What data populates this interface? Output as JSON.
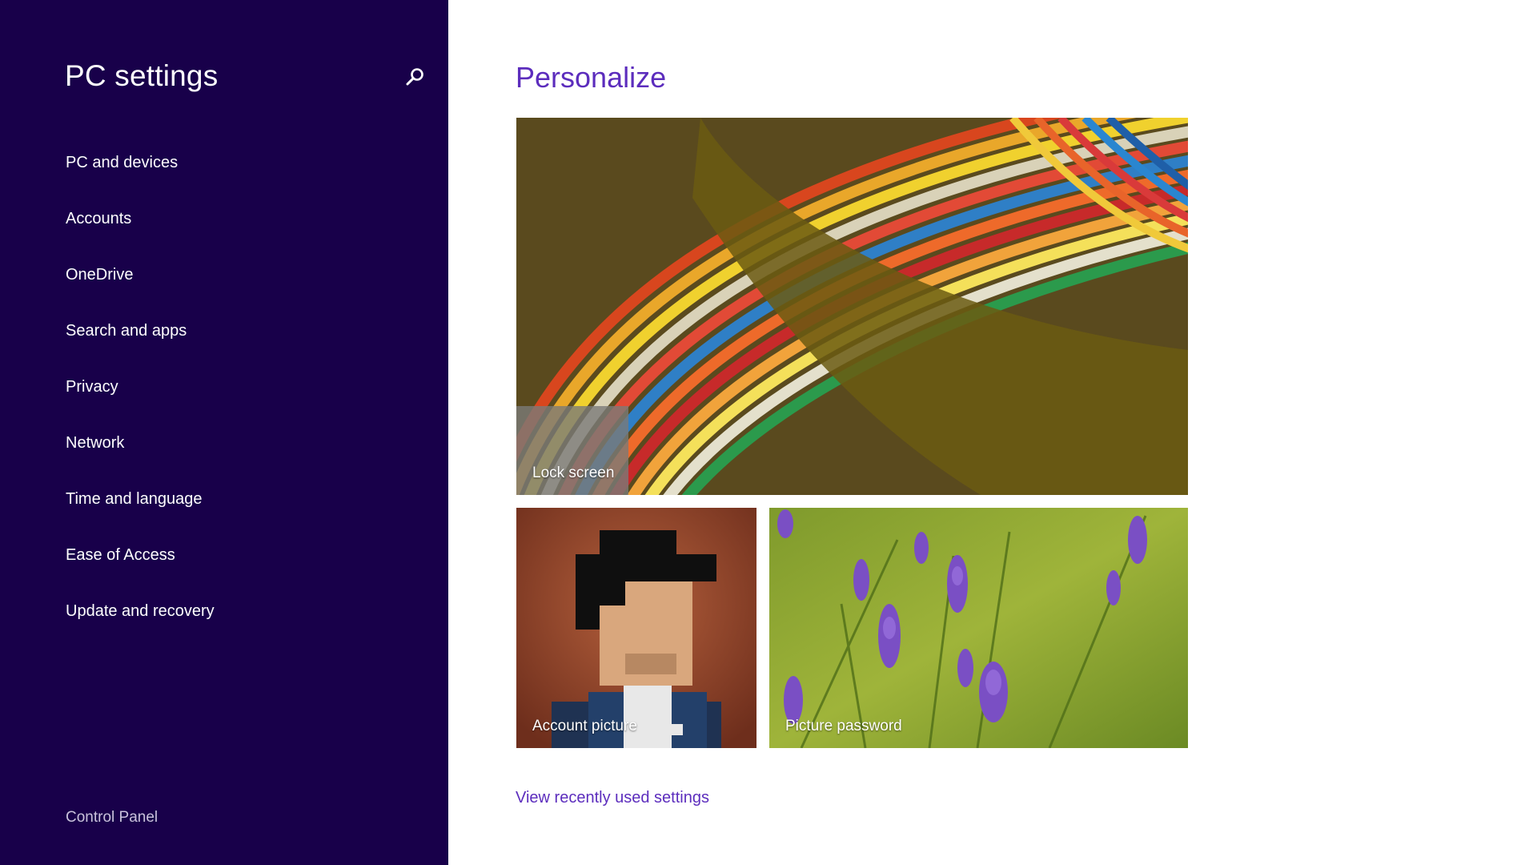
{
  "sidebar": {
    "title": "PC settings",
    "search_icon": "search-icon",
    "items": [
      {
        "label": "PC and devices"
      },
      {
        "label": "Accounts"
      },
      {
        "label": "OneDrive"
      },
      {
        "label": "Search and apps"
      },
      {
        "label": "Privacy"
      },
      {
        "label": "Network"
      },
      {
        "label": "Time and language"
      },
      {
        "label": "Ease of Access"
      },
      {
        "label": "Update and recovery"
      }
    ],
    "control_panel": "Control Panel"
  },
  "main": {
    "title": "Personalize",
    "tiles": {
      "lock_screen": "Lock screen",
      "account_picture": "Account picture",
      "picture_password": "Picture password"
    },
    "recent_link": "View recently used settings"
  },
  "colors": {
    "sidebar_bg": "#18004a",
    "accent": "#5c2dbd",
    "main_bg": "#ffffff"
  }
}
